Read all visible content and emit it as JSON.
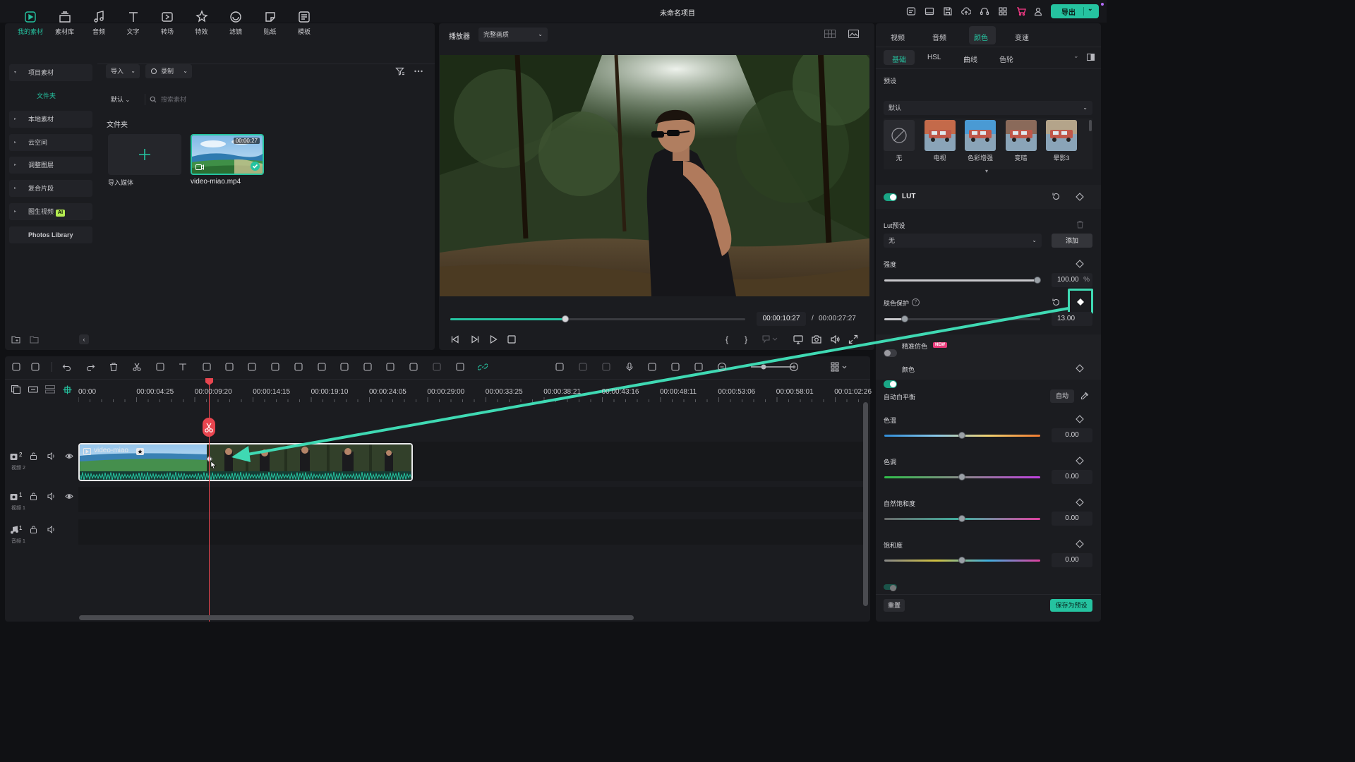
{
  "app": {
    "title": "未命名项目",
    "export_label": "导出"
  },
  "toolbar": {
    "items": [
      {
        "label": "我的素材",
        "icon": "media-icon"
      },
      {
        "label": "素材库",
        "icon": "library-icon"
      },
      {
        "label": "音频",
        "icon": "music-icon"
      },
      {
        "label": "文字",
        "icon": "text-icon"
      },
      {
        "label": "转场",
        "icon": "transition-icon"
      },
      {
        "label": "特效",
        "icon": "effects-icon"
      },
      {
        "label": "滤镜",
        "icon": "filter-icon"
      },
      {
        "label": "贴纸",
        "icon": "sticker-icon"
      },
      {
        "label": "模板",
        "icon": "template-icon"
      }
    ]
  },
  "media_panel": {
    "nav": [
      {
        "label": "项目素材",
        "expanded": true
      },
      {
        "label": "文件夹",
        "sub": true
      },
      {
        "label": "本地素材"
      },
      {
        "label": "云空间"
      },
      {
        "label": "调整图层"
      },
      {
        "label": "复合片段"
      },
      {
        "label": "图生视频",
        "badge": "AI"
      },
      {
        "label": "Photos Library"
      }
    ],
    "import_label": "导入",
    "record_label": "录制",
    "sort_label": "默认",
    "search_placeholder": "搜索素材",
    "folder_title": "文件夹",
    "import_media_label": "导入媒体",
    "clip": {
      "name": "video-miao.mp4",
      "duration": "00:00:27"
    }
  },
  "player": {
    "label": "播放器",
    "quality": "完整画质",
    "current_time": "00:00:10:27",
    "total_time": "00:00:27:27",
    "progress": 0.39,
    "time_sep": "/"
  },
  "timeline": {
    "ruler": [
      "00:00",
      "00:00:04:25",
      "00:00:09:20",
      "00:00:14:15",
      "00:00:19:10",
      "00:00:24:05",
      "00:00:29:00",
      "00:00:33:25",
      "00:00:38:21",
      "00:00:43:16",
      "00:00:48:11",
      "00:00:53:06",
      "00:00:58:01",
      "00:01:02:26"
    ],
    "tracks": [
      {
        "num": "2",
        "name": "视频 2",
        "type": "video"
      },
      {
        "num": "1",
        "name": "视频 1",
        "type": "video"
      },
      {
        "num": "1",
        "name": "音频 1",
        "type": "audio"
      }
    ],
    "clip_label": "video-miao"
  },
  "props": {
    "tabs": [
      "视频",
      "音频",
      "颜色",
      "变速"
    ],
    "active_tab": "颜色",
    "subtabs": [
      "基础",
      "HSL",
      "曲线",
      "色轮"
    ],
    "active_subtab": "基础",
    "preset_title": "预设",
    "preset_select": "默认",
    "presets": [
      "无",
      "电视",
      "色彩增强",
      "变暗",
      "晕影3"
    ],
    "lut_title": "LUT",
    "lut_preset_label": "Lut预设",
    "lut_preset_value": "无",
    "lut_add": "添加",
    "intensity_label": "强度",
    "intensity_value": "100.00",
    "intensity_unit": "%",
    "intensity_level": 0.98,
    "skin_label": "肤色保护",
    "skin_value": "13.00",
    "skin_level": 0.13,
    "precise_label": "精准仿色",
    "new_badge": "NEW",
    "color_title": "颜色",
    "awb_label": "自动白平衡",
    "auto_label": "自动",
    "color_sliders": [
      {
        "label": "色温",
        "value": "0.00"
      },
      {
        "label": "色调",
        "value": "0.00"
      },
      {
        "label": "自然饱和度",
        "value": "0.00"
      },
      {
        "label": "饱和度",
        "value": "0.00"
      }
    ],
    "reset_label": "重置",
    "save_preset_label": "保存为预设"
  },
  "colors": {
    "accent": "#25c3a0",
    "playhead": "#e8454f",
    "annotation": "#3fd9b3"
  }
}
